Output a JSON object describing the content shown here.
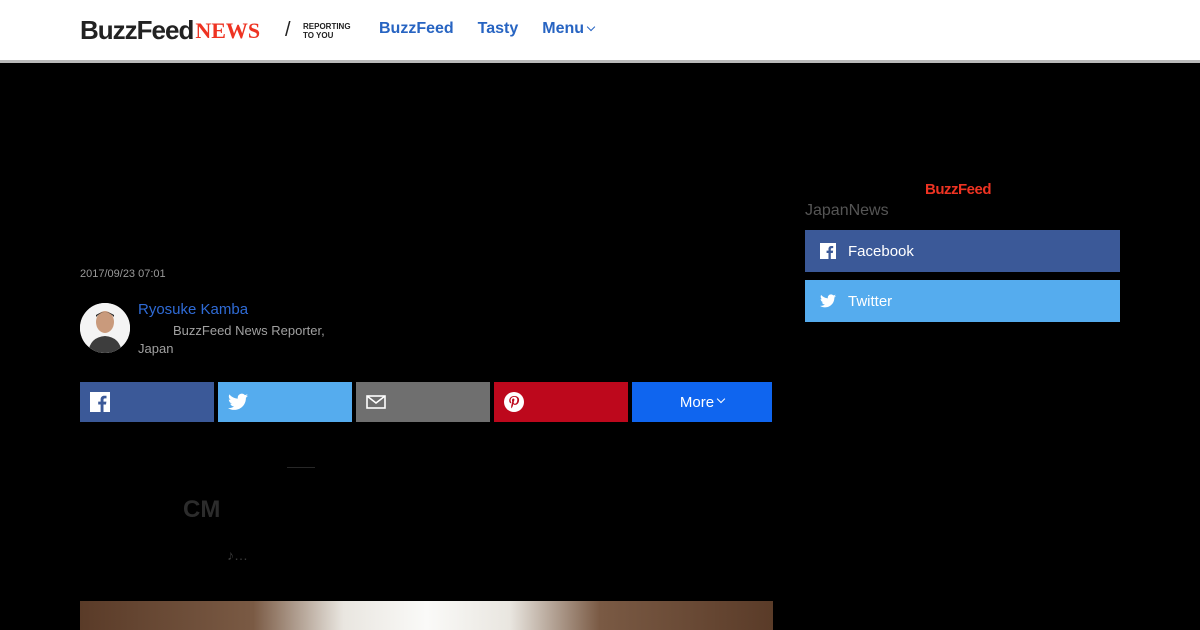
{
  "header": {
    "logo_buzz": "BuzzFeed",
    "logo_news": "NEWS",
    "logo_slash": "/",
    "tagline": "REPORTING TO YOU",
    "nav": [
      "BuzzFeed",
      "Tasty",
      "Menu"
    ]
  },
  "article": {
    "date": "2017/09/23 07:01",
    "author_name": "Ryosuke Kamba",
    "author_role_line1": "BuzzFeed News Reporter,",
    "author_role_line2": "Japan",
    "share_more_label": "More",
    "text_dash": "——",
    "text_cm": "CM",
    "text_note": "♪…"
  },
  "sidebar": {
    "logo": "BuzzFeed",
    "label": "JapanNews",
    "facebook_label": "Facebook",
    "twitter_label": "Twitter"
  },
  "colors": {
    "facebook": "#3b5998",
    "twitter": "#55acee",
    "email": "#6f6f6f",
    "pinterest": "#bd081c",
    "more": "#0f65ef",
    "nav_link": "#2764c2",
    "brand_red": "#ee3322"
  }
}
